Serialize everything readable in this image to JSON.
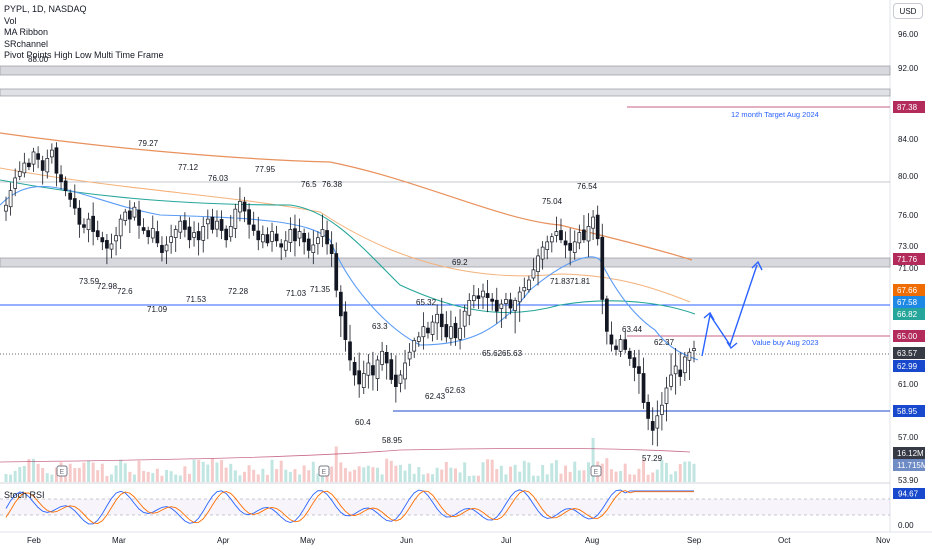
{
  "header": {
    "symbol_line": "PYPL, 1D, NASDAQ",
    "indicators": [
      "Vol",
      "MA Ribbon",
      "SRchannel",
      "Pivot Points High Low Multi Time Frame"
    ],
    "currency_button": "USD"
  },
  "stoch": {
    "label": "Stoch RSI",
    "k_value": "94.67",
    "axis_ticks": [
      "0.00"
    ]
  },
  "chart_data": {
    "type": "candlestick",
    "symbol": "PYPL",
    "timeframe": "1D",
    "exchange": "NASDAQ",
    "y_axis_ticks": [
      96.0,
      92.0,
      84.0,
      80.0,
      76.0,
      73.0,
      71.0,
      61.0,
      57.0,
      53.9
    ],
    "x_axis_ticks": [
      "Feb",
      "Mar",
      "Apr",
      "May",
      "Jun",
      "Jul",
      "Aug",
      "Sep",
      "Oct",
      "Nov"
    ],
    "price_badges": [
      {
        "label": "87.38",
        "color": "#b22b5a"
      },
      {
        "label": "71.76",
        "color": "#b22b5a"
      },
      {
        "label": "67.66",
        "color": "#ef6c00"
      },
      {
        "label": "67.58",
        "color": "#1e88e5"
      },
      {
        "label": "66.82",
        "color": "#26a69a"
      },
      {
        "label": "65.00",
        "color": "#b22b5a"
      },
      {
        "label": "63.57",
        "color": "#363a45"
      },
      {
        "label": "62.99",
        "color": "#1848cc"
      },
      {
        "label": "58.95",
        "color": "#1848cc"
      },
      {
        "label": "16.12M",
        "color": "#363a45"
      },
      {
        "label": "11.715M",
        "color": "#6f8cc5"
      }
    ],
    "pivot_labels": [
      "88.00",
      "79.27",
      "77.12",
      "76.03",
      "77.95",
      "76.5",
      "76.38",
      "73.59",
      "72.98",
      "72.6",
      "71.09",
      "71.53",
      "72.28",
      "71.03",
      "71.35",
      "69.2",
      "65.32",
      "63.3",
      "60.4",
      "58.95",
      "62.43",
      "62.63",
      "65.62",
      "65.63",
      "75.04",
      "76.54",
      "71.83",
      "71.81",
      "63.44",
      "62.37",
      "57.29"
    ],
    "annotations": [
      "12 month Target Aug 2024",
      "Value buy Aug 2023"
    ],
    "closes": [
      77.0,
      78.5,
      79.8,
      80.5,
      81.4,
      81.0,
      82.6,
      81.8,
      80.6,
      81.9,
      82.8,
      80.3,
      79.4,
      78.5,
      77.6,
      76.7,
      75.1,
      74.8,
      75.6,
      74.4,
      73.9,
      73.4,
      72.8,
      73.2,
      74.0,
      75.6,
      76.3,
      75.6,
      76.8,
      75.0,
      74.5,
      73.9,
      74.7,
      73.3,
      72.4,
      73.1,
      73.9,
      74.6,
      75.4,
      74.6,
      73.6,
      74.3,
      73.6,
      74.9,
      75.6,
      74.6,
      75.4,
      74.5,
      73.6,
      74.9,
      76.6,
      77.4,
      76.4,
      75.1,
      74.5,
      73.6,
      74.1,
      73.3,
      74.4,
      73.5,
      72.9,
      73.5,
      74.6,
      73.5,
      74.4,
      73.4,
      72.6,
      73.1,
      73.8,
      74.6,
      73.2,
      72.3,
      68.6,
      66.3,
      64.6,
      62.6,
      61.6,
      61.0,
      61.7,
      62.4,
      61.6,
      62.6,
      63.3,
      62.4,
      61.3,
      60.8,
      61.6,
      62.4,
      63.2,
      64.5,
      64.9,
      65.6,
      65.2,
      65.9,
      66.4,
      65.6,
      64.9,
      65.6,
      64.8,
      65.5,
      66.6,
      67.5,
      68.0,
      67.7,
      68.5,
      67.8,
      67.4,
      66.6,
      67.1,
      67.6,
      66.8,
      67.5,
      68.4,
      68.9,
      69.7,
      70.8,
      72.1,
      72.9,
      73.4,
      73.9,
      74.4,
      73.6,
      73.1,
      72.6,
      73.4,
      74.3,
      73.6,
      74.9,
      75.8,
      73.7,
      67.6,
      65.3,
      64.1,
      63.5,
      64.6,
      63.5,
      62.7,
      62.1,
      61.7,
      59.6,
      58.4,
      57.5,
      58.6,
      59.4,
      60.7,
      61.6,
      62.2,
      61.5,
      62.8,
      63.2,
      63.6
    ]
  }
}
